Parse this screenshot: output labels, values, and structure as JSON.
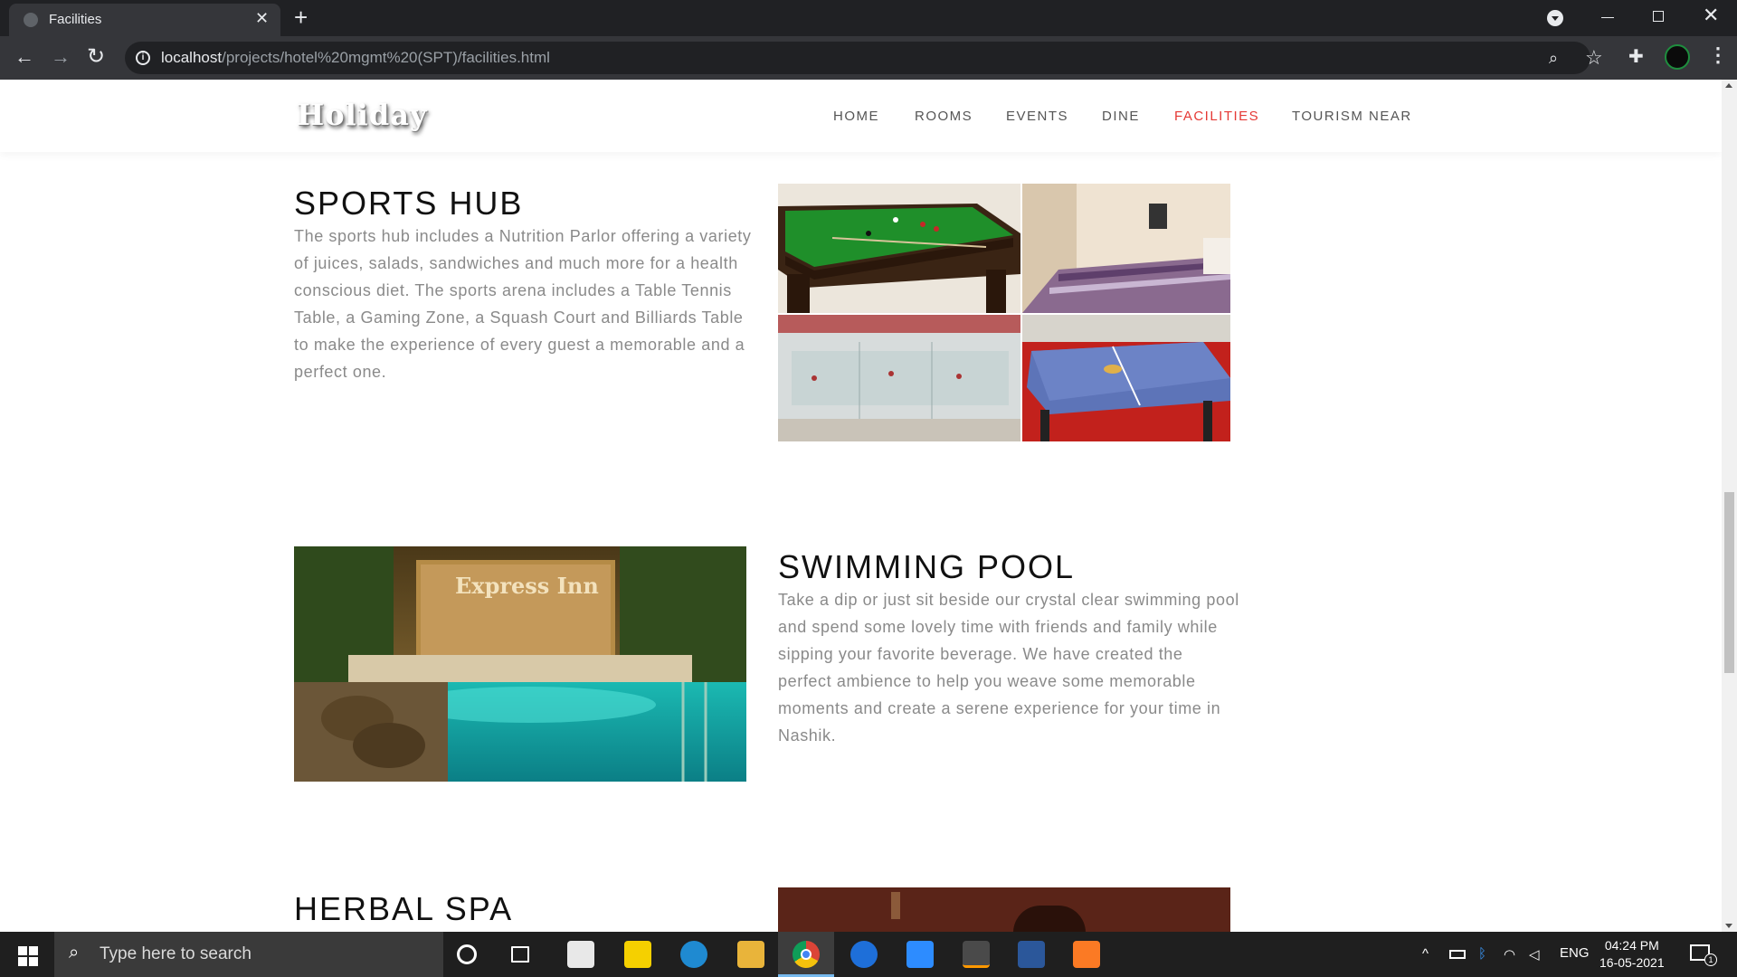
{
  "browser": {
    "tab_title": "Facilities",
    "url_host": "localhost",
    "url_path": "/projects/hotel%20mgmt%20(SPT)/facilities.html"
  },
  "site": {
    "logo": "Holiday",
    "nav": [
      {
        "label": "HOME",
        "active": false
      },
      {
        "label": "ROOMS",
        "active": false
      },
      {
        "label": "EVENTS",
        "active": false
      },
      {
        "label": "DINE",
        "active": false
      },
      {
        "label": "FACILITIES",
        "active": true
      },
      {
        "label": "TOURISM NEAR",
        "active": false
      }
    ],
    "accent_color": "#e53935"
  },
  "sections": {
    "sports": {
      "title": "SPORTS HUB",
      "description": "The sports hub includes a Nutrition Parlor offering a variety of juices, salads, sandwiches and much more for a health conscious diet. The sports arena includes a Table Tennis Table, a Gaming Zone, a Squash Court and Billiards Table to make the experience of every guest a memorable and a perfect one."
    },
    "pool": {
      "title": "SWIMMING POOL",
      "description": "Take a dip or just sit beside our crystal clear swimming pool and spend some lovely time with friends and family while sipping your favorite beverage. We have created the perfect ambience to help you weave some memorable moments and create a serene experience for your time in Nashik.",
      "photo_sign": "Express Inn"
    },
    "spa": {
      "title": "HERBAL SPA"
    }
  },
  "taskbar": {
    "search_placeholder": "Type here to search",
    "language": "ENG",
    "time": "04:24 PM",
    "date": "16-05-2021",
    "notification_count": "1"
  }
}
